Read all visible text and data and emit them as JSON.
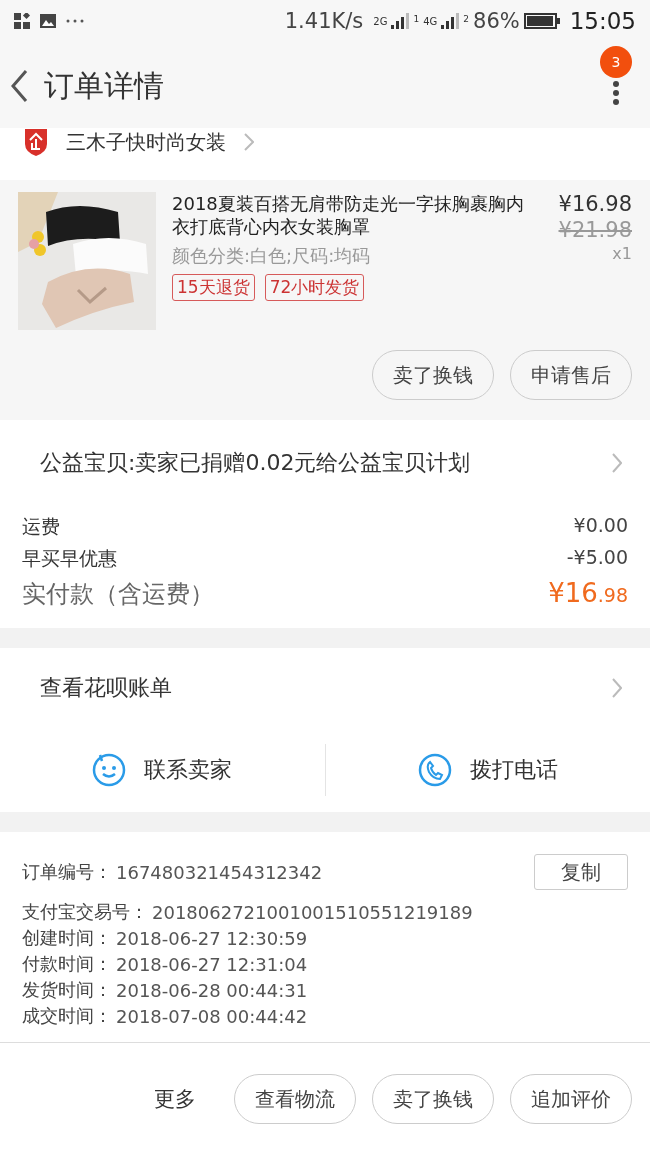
{
  "status_bar": {
    "net_speed": "1.41K/s",
    "sim1": "2G",
    "sim1_index": "1",
    "sim2": "4G",
    "sim2_index": "2",
    "battery": "86%",
    "time": "15:05"
  },
  "header": {
    "title": "订单详情",
    "badge": "3"
  },
  "shop": {
    "name": "三木子快时尚女装"
  },
  "product": {
    "title": "2018夏装百搭无肩带防走光一字抹胸裹胸内衣打底背心内衣女装胸罩",
    "price": "¥16.98",
    "original_price": "¥21.98",
    "quantity": "x1",
    "spec": "颜色分类:白色;尺码:均码",
    "tags": [
      "15天退货",
      "72小时发货"
    ],
    "buttons": [
      "卖了换钱",
      "申请售后"
    ]
  },
  "charity": {
    "text": "公益宝贝:卖家已捐赠0.02元给公益宝贝计划"
  },
  "fees": [
    {
      "label": "运费",
      "value": "¥0.00"
    },
    {
      "label": "早买早优惠",
      "value": "-¥5.00"
    }
  ],
  "total": {
    "label": "实付款（含运费）",
    "amount_main": "¥16",
    "amount_small": ".98"
  },
  "huabei": {
    "label": "查看花呗账单"
  },
  "contact": [
    {
      "kind": "chat",
      "label": "联系卖家"
    },
    {
      "kind": "phone",
      "label": "拨打电话"
    }
  ],
  "order_info": {
    "copy_button": "复制",
    "rows": [
      {
        "label": "订单编号：",
        "value": "167480321454312342"
      },
      {
        "label": "支付宝交易号：",
        "value": "2018062721001001510551219189"
      },
      {
        "label": "创建时间：",
        "value": "2018-06-27 12:30:59"
      },
      {
        "label": "付款时间：",
        "value": "2018-06-27 12:31:04"
      },
      {
        "label": "发货时间：",
        "value": "2018-06-28 00:44:31"
      },
      {
        "label": "成交时间：",
        "value": "2018-07-08 00:44:42"
      }
    ]
  },
  "footer": {
    "more": "更多",
    "buttons": [
      "查看物流",
      "卖了换钱",
      "追加评价"
    ]
  }
}
